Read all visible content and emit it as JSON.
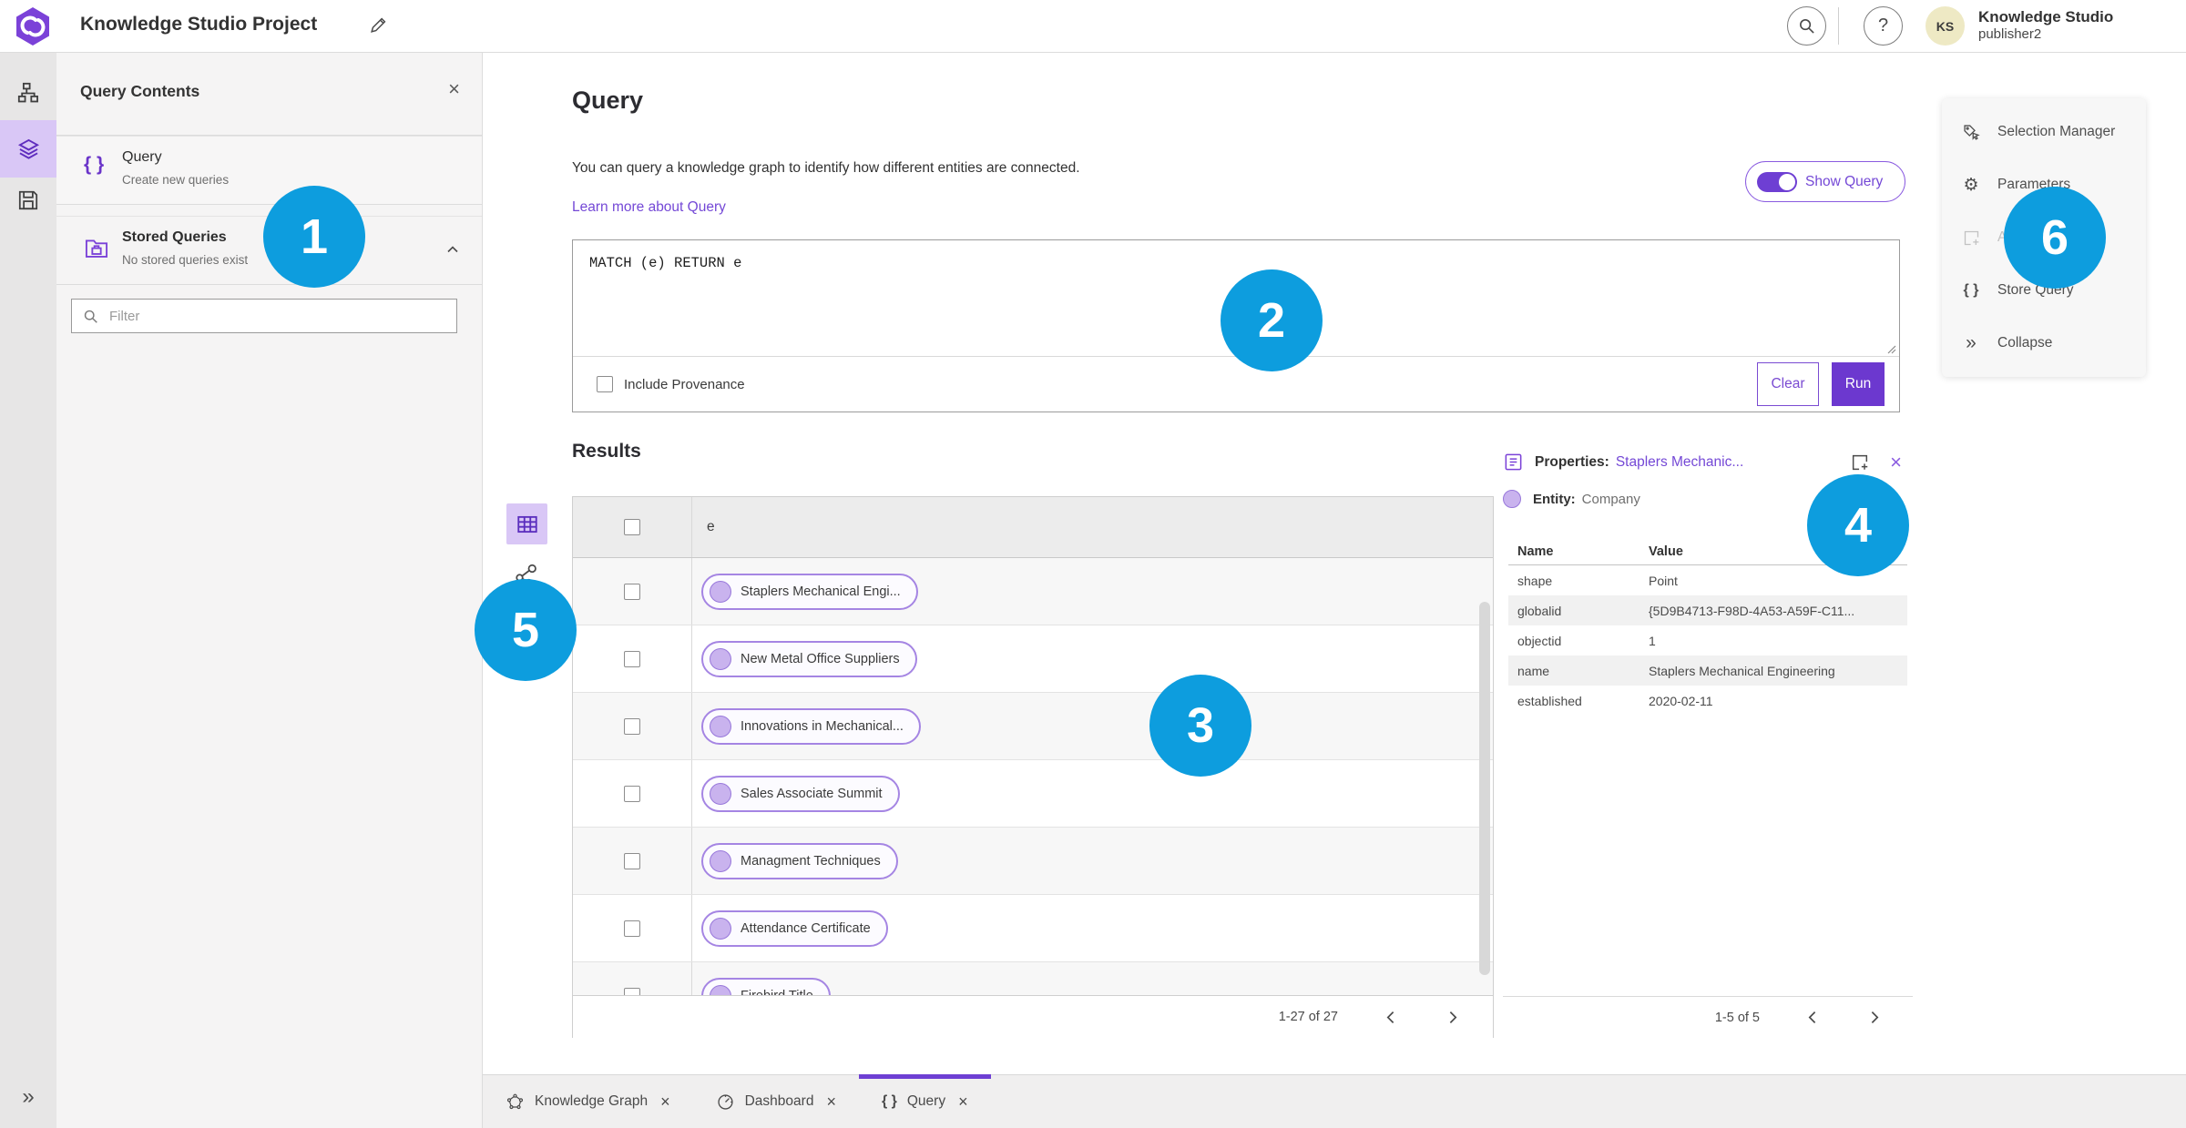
{
  "glyphs": {
    "close": "×",
    "question": "?",
    "gear": "⚙",
    "braces": "{ }",
    "collapse": "»",
    "expand": "»"
  },
  "colors": {
    "accent_purple": "#6e3fd3",
    "link_purple": "#7448d6",
    "chip_fill": "#c9b3ee",
    "callout_blue": "#0d9dde",
    "selected_rail": "#d9c7f6"
  },
  "topbar": {
    "title": "Knowledge Studio Project",
    "user": {
      "initials": "KS",
      "org": "Knowledge Studio",
      "name": "publisher2"
    }
  },
  "contents": {
    "title": "Query Contents",
    "query_item": {
      "label": "Query",
      "desc": "Create new queries"
    },
    "stored_item": {
      "label": "Stored Queries",
      "desc": "No stored queries exist"
    },
    "filter_placeholder": "Filter"
  },
  "query": {
    "heading": "Query",
    "description": "You can query a knowledge graph to identify how different entities are connected.",
    "learn_more": "Learn more about Query",
    "show_query": "Show Query",
    "text": "MATCH (e) RETURN e",
    "include_provenance": "Include Provenance",
    "clear": "Clear",
    "run": "Run"
  },
  "results": {
    "heading": "Results",
    "column": "e",
    "rows": [
      "Staplers Mechanical Engi...",
      "New Metal Office Suppliers",
      "Innovations in Mechanical...",
      "Sales Associate Summit",
      "Managment Techniques",
      "Attendance Certificate",
      "Firebird Title"
    ],
    "pagination": "1-27 of 27"
  },
  "properties": {
    "title": "Properties:",
    "link": "Staplers Mechanic...",
    "entity_label": "Entity:",
    "entity_value": "Company",
    "col_name": "Name",
    "col_value": "Value",
    "rows": [
      {
        "n": "shape",
        "v": "Point"
      },
      {
        "n": "globalid",
        "v": "{5D9B4713-F98D-4A53-A59F-C11..."
      },
      {
        "n": "objectid",
        "v": "1"
      },
      {
        "n": "name",
        "v": "Staplers Mechanical Engineering"
      },
      {
        "n": "established",
        "v": "2020-02-11"
      }
    ],
    "pagination": "1-5 of 5"
  },
  "menu": {
    "items": [
      {
        "label": "Selection Manager"
      },
      {
        "label": "Parameters"
      },
      {
        "label": "Add To Map"
      },
      {
        "label": "Store Query"
      },
      {
        "label": "Collapse"
      }
    ]
  },
  "tabs": [
    {
      "label": "Knowledge Graph"
    },
    {
      "label": "Dashboard"
    },
    {
      "label": "Query"
    }
  ],
  "callouts": [
    {
      "n": "1"
    },
    {
      "n": "2"
    },
    {
      "n": "3"
    },
    {
      "n": "4"
    },
    {
      "n": "5"
    },
    {
      "n": "6"
    }
  ]
}
